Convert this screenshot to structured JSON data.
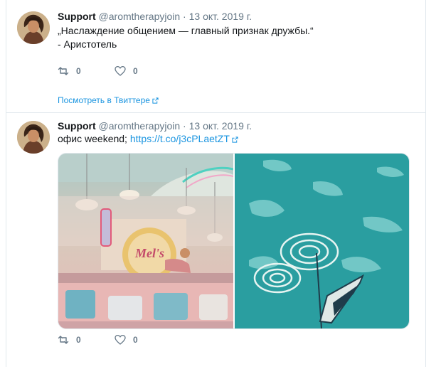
{
  "tweets": [
    {
      "name": "Support",
      "handle": "@aromtherapyjoin",
      "separator": "·",
      "date": "13 окт. 2019 г.",
      "text_line1": "„Наслаждение общением — главный признак дружбы.“",
      "text_line2": "- Аристотель",
      "retweets": "0",
      "likes": "0",
      "view_link": "Посмотреть в Твиттере"
    },
    {
      "name": "Support",
      "handle": "@aromtherapyjoin",
      "separator": "·",
      "date": "13 окт. 2019 г.",
      "text": "офис weekend;",
      "link": "https://t.co/j3cPLaetZT",
      "photo_sign": "Mel's",
      "retweets": "0",
      "likes": "0"
    }
  ],
  "colors": {
    "link": "#1b95e0",
    "text": "#14171a",
    "muted": "#657786",
    "border": "#e1e8ed",
    "sea": "#2a9ea0",
    "diner_pink": "#e8b7b5"
  },
  "icons": [
    "avatar",
    "retweet-icon",
    "heart-icon",
    "external-link-icon"
  ]
}
